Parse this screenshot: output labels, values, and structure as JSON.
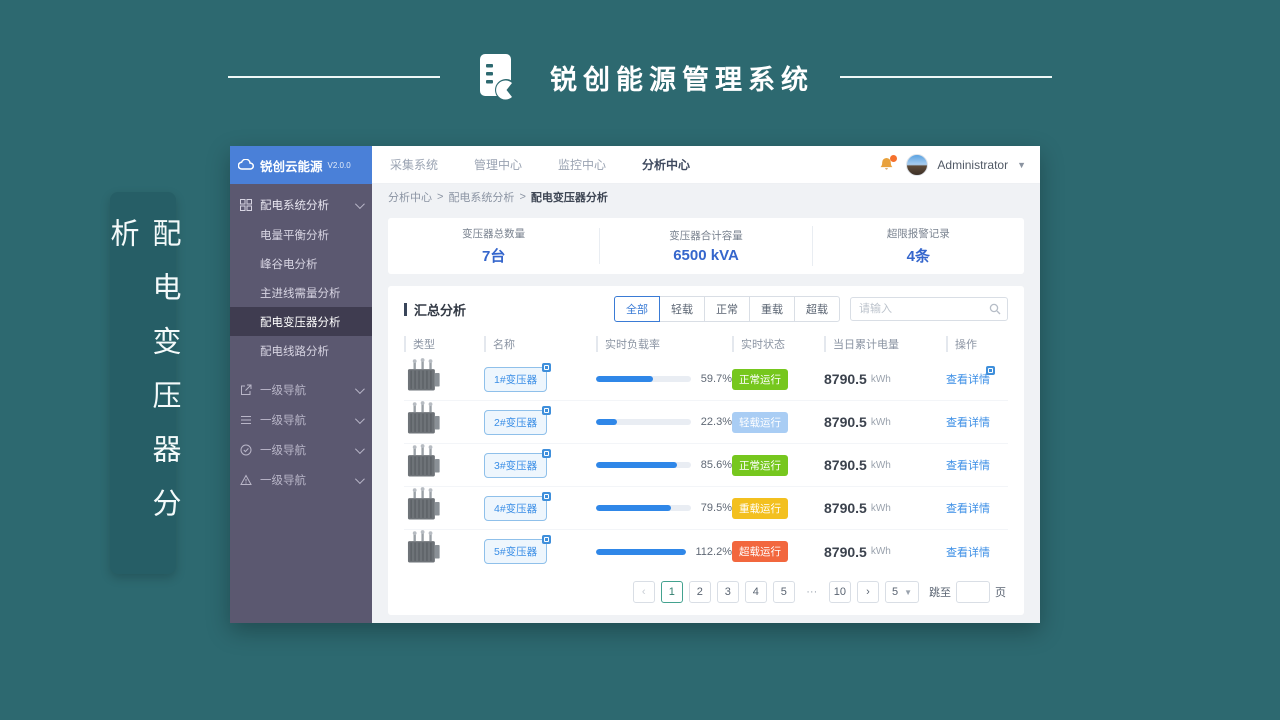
{
  "page": {
    "banner_title": "锐创能源管理系统",
    "vertical_title": "配电变压器分析",
    "colors": {
      "page_bg": "#2d6970",
      "vertical_box_bg": "#265e66",
      "sidebar_bg": "#5b5870",
      "logo_bar_bg": "#4a80d8",
      "accent_blue": "#3a8ee6",
      "stat_value_blue": "#3566cc",
      "progress_blue": "#2f87e8",
      "status_normal_green": "#76c71e",
      "status_light_blue": "#a9cdf4",
      "status_heavy_yellow": "#f3c01f",
      "status_over_red": "#f2673e"
    }
  },
  "app": {
    "logo": {
      "name": "锐创云能源",
      "version": "V2.0.0"
    },
    "topnav": {
      "tabs": [
        {
          "label": "采集系统"
        },
        {
          "label": "管理中心"
        },
        {
          "label": "监控中心"
        },
        {
          "label": "分析中心"
        }
      ],
      "active_tab": "分析中心",
      "user": {
        "name": "Administrator"
      }
    },
    "breadcrumb": {
      "separator": ">",
      "items": [
        {
          "label": "分析中心"
        },
        {
          "label": "配电系统分析"
        },
        {
          "label": "配电变压器分析"
        }
      ]
    },
    "sidebar": {
      "groups": [
        {
          "label": "配电系统分析",
          "icon": "grid-icon",
          "expanded": true,
          "children": [
            {
              "label": "电量平衡分析"
            },
            {
              "label": "峰谷电分析"
            },
            {
              "label": "主进线需量分析"
            },
            {
              "label": "配电变压器分析",
              "active": true
            },
            {
              "label": "配电线路分析"
            }
          ]
        },
        {
          "label": "一级导航",
          "icon": "share-icon"
        },
        {
          "label": "一级导航",
          "icon": "list-icon"
        },
        {
          "label": "一级导航",
          "icon": "check-circle-icon"
        },
        {
          "label": "一级导航",
          "icon": "warning-icon"
        }
      ]
    },
    "stats": [
      {
        "label": "变压器总数量",
        "value": "7台"
      },
      {
        "label": "变压器合计容量",
        "value": "6500 kVA"
      },
      {
        "label": "超限报警记录",
        "value": "4条"
      }
    ],
    "panel": {
      "title": "汇总分析",
      "filters": [
        {
          "label": "全部",
          "active": true
        },
        {
          "label": "轻载"
        },
        {
          "label": "正常"
        },
        {
          "label": "重载"
        },
        {
          "label": "超载"
        }
      ],
      "search_placeholder": "请输入",
      "table": {
        "headers": [
          "类型",
          "名称",
          "实时负载率",
          "实时状态",
          "当日累计电量",
          "操作"
        ],
        "rows": [
          {
            "name": "1#变压器",
            "load": "59.7%",
            "status": "正常运行",
            "status_color": "#76c71e",
            "energy": "8790.5",
            "energy_unit": "kWh",
            "action": "查看详情"
          },
          {
            "name": "2#变压器",
            "load": "22.3%",
            "status": "轻载运行",
            "status_color": "#a9cdf4",
            "energy": "8790.5",
            "energy_unit": "kWh",
            "action": "查看详情"
          },
          {
            "name": "3#变压器",
            "load": "85.6%",
            "status": "正常运行",
            "status_color": "#76c71e",
            "energy": "8790.5",
            "energy_unit": "kWh",
            "action": "查看详情"
          },
          {
            "name": "4#变压器",
            "load": "79.5%",
            "status": "重载运行",
            "status_color": "#f3c01f",
            "energy": "8790.5",
            "energy_unit": "kWh",
            "action": "查看详情"
          },
          {
            "name": "5#变压器",
            "load": "112.2%",
            "status": "超载运行",
            "status_color": "#f2673e",
            "energy": "8790.5",
            "energy_unit": "kWh",
            "action": "查看详情"
          }
        ]
      },
      "pagination": {
        "prev": "‹",
        "pages": [
          "1",
          "2",
          "3",
          "4",
          "5",
          "···",
          "10"
        ],
        "active_page": "1",
        "next": "›",
        "page_size": "5",
        "jump_label": "跳至",
        "jump_unit": "页"
      }
    }
  }
}
